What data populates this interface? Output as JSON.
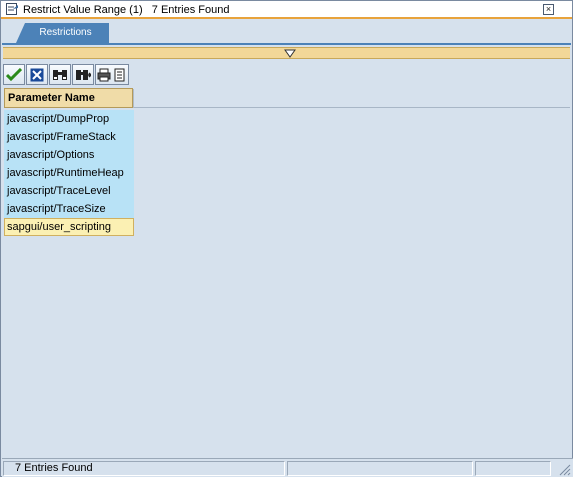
{
  "window": {
    "title": "Restrict Value Range (1)   7 Entries Found",
    "close_glyph": "×"
  },
  "tabs": [
    {
      "label": "Restrictions",
      "active": true
    }
  ],
  "toolbar": {
    "buttons": [
      {
        "name": "confirm",
        "icon": "checkmark-icon"
      },
      {
        "name": "cancel",
        "icon": "cancel-icon"
      },
      {
        "name": "find",
        "icon": "binoculars-icon"
      },
      {
        "name": "find-next",
        "icon": "binoculars-next-icon"
      },
      {
        "name": "print",
        "icon": "printer-icon"
      }
    ]
  },
  "table": {
    "column_header": "Parameter Name",
    "rows": [
      "javascript/DumpProp",
      "javascript/FrameStack",
      "javascript/Options",
      "javascript/RuntimeHeap",
      "javascript/TraceLevel",
      "javascript/TraceSize",
      "sapgui/user_scripting"
    ],
    "selected_index": 6
  },
  "status": {
    "message": "7 Entries Found"
  },
  "colors": {
    "accent": "#e8a33c",
    "tab": "#4c82b8",
    "row": "#b8e2f6",
    "selected_row": "#fbf0b3",
    "background": "#d6e1ed"
  }
}
